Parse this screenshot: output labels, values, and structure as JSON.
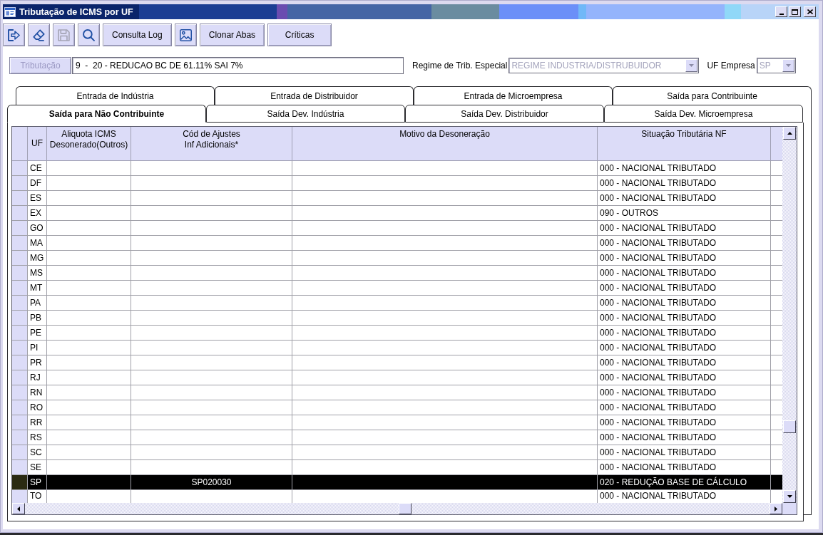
{
  "window": {
    "title": "Tributação de ICMS por UF"
  },
  "toolbar": [
    {
      "kind": "icon",
      "disabled": false
    },
    {
      "kind": "icon",
      "disabled": false
    },
    {
      "kind": "icon",
      "disabled": true
    },
    {
      "kind": "icon",
      "disabled": false
    },
    {
      "kind": "text",
      "label": "Consulta Log",
      "disabled": false
    },
    {
      "kind": "icon",
      "disabled": false
    },
    {
      "kind": "text",
      "label": "Clonar Abas",
      "disabled": false
    },
    {
      "kind": "text",
      "label": "Críticas",
      "disabled": false
    }
  ],
  "form": {
    "tributacao_button": {
      "label": "Tributação",
      "disabled": true
    },
    "tributacao_field": {
      "value": "9  -  20 - REDUCAO BC DE 61.11% SAI 7%"
    },
    "regime": {
      "label": "Regime de Trib. Especial",
      "value": "REGIME INDUSTRIA/DISTRUBUIDOR",
      "disabled": true
    },
    "uf_empresa": {
      "label": "UF Empresa",
      "value": "SP",
      "disabled": true
    }
  },
  "tab_rows": [
    [
      {
        "label": "Entrada de Indústria",
        "selected": false
      },
      {
        "label": "Entrada de Distribuidor",
        "selected": false
      },
      {
        "label": "Entrada de Microempresa",
        "selected": false
      },
      {
        "label": "Saída para Contribuinte",
        "selected": false
      }
    ],
    [
      {
        "label": "Saída para Não Contribuinte",
        "selected": true
      },
      {
        "label": "Saída Dev. Indústria",
        "selected": false
      },
      {
        "label": "Saída Dev. Distribuidor",
        "selected": false
      },
      {
        "label": "Saída Dev. Microempresa",
        "selected": false
      }
    ]
  ],
  "table": {
    "columns": [
      "UF",
      "Aliquota ICMS\nDesonerado(Outros)",
      "Cód de Ajustes\nInf Adicionais*",
      "Motivo da Desoneração",
      "Situação Tributária NF"
    ],
    "rows": [
      {
        "uf": "CE",
        "situacao_nf": "000 - NACIONAL TRIBUTADO",
        "selected": false
      },
      {
        "uf": "DF",
        "situacao_nf": "000 - NACIONAL TRIBUTADO",
        "selected": false
      },
      {
        "uf": "ES",
        "situacao_nf": "000 - NACIONAL TRIBUTADO",
        "selected": false
      },
      {
        "uf": "EX",
        "situacao_nf": "090 - OUTROS",
        "selected": false
      },
      {
        "uf": "GO",
        "situacao_nf": "000 - NACIONAL TRIBUTADO",
        "selected": false
      },
      {
        "uf": "MA",
        "situacao_nf": "000 - NACIONAL TRIBUTADO",
        "selected": false
      },
      {
        "uf": "MG",
        "situacao_nf": "000 - NACIONAL TRIBUTADO",
        "selected": false
      },
      {
        "uf": "MS",
        "situacao_nf": "000 - NACIONAL TRIBUTADO",
        "selected": false
      },
      {
        "uf": "MT",
        "situacao_nf": "000 - NACIONAL TRIBUTADO",
        "selected": false
      },
      {
        "uf": "PA",
        "situacao_nf": "000 - NACIONAL TRIBUTADO",
        "selected": false
      },
      {
        "uf": "PB",
        "situacao_nf": "000 - NACIONAL TRIBUTADO",
        "selected": false
      },
      {
        "uf": "PE",
        "situacao_nf": "000 - NACIONAL TRIBUTADO",
        "selected": false
      },
      {
        "uf": "PI",
        "situacao_nf": "000 - NACIONAL TRIBUTADO",
        "selected": false
      },
      {
        "uf": "PR",
        "situacao_nf": "000 - NACIONAL TRIBUTADO",
        "selected": false
      },
      {
        "uf": "RJ",
        "situacao_nf": "000 - NACIONAL TRIBUTADO",
        "selected": false
      },
      {
        "uf": "RN",
        "situacao_nf": "000 - NACIONAL TRIBUTADO",
        "selected": false
      },
      {
        "uf": "RO",
        "situacao_nf": "000 - NACIONAL TRIBUTADO",
        "selected": false
      },
      {
        "uf": "RR",
        "situacao_nf": "000 - NACIONAL TRIBUTADO",
        "selected": false
      },
      {
        "uf": "RS",
        "situacao_nf": "000 - NACIONAL TRIBUTADO",
        "selected": false
      },
      {
        "uf": "SC",
        "situacao_nf": "000 - NACIONAL TRIBUTADO",
        "selected": false
      },
      {
        "uf": "SE",
        "situacao_nf": "000 - NACIONAL TRIBUTADO",
        "selected": false
      },
      {
        "uf": "SP",
        "cod_ajustes": "SP020030",
        "situacao_nf": "020 - REDUÇÃO BASE DE CÁLCULO",
        "selected": true
      },
      {
        "uf": "TO",
        "situacao_nf": "000 - NACIONAL TRIBUTADO",
        "selected": false
      }
    ]
  }
}
